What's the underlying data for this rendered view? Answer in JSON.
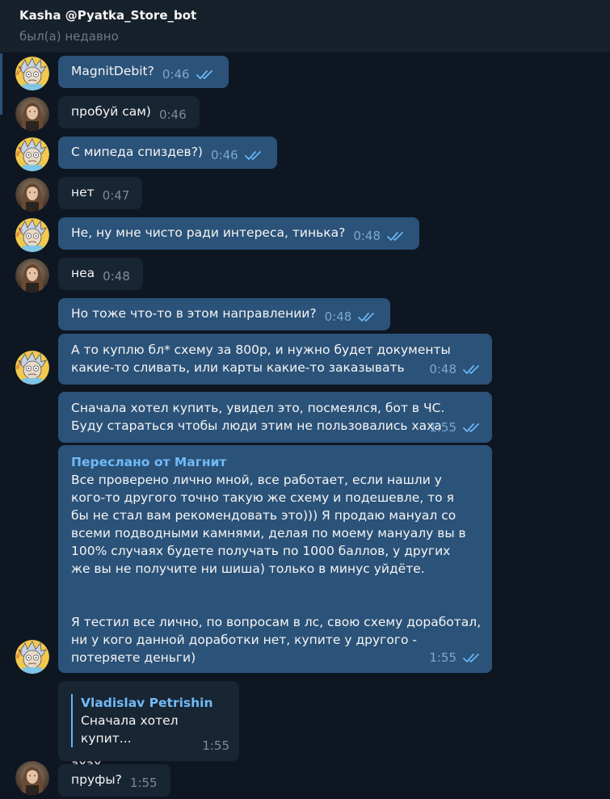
{
  "chat": {
    "title": "Kasha @Pyatka_Store_bot",
    "status": "был(а) недавно"
  },
  "messages": [
    {
      "text": "MagnitDebit?",
      "time": "0:46",
      "read": true
    },
    {
      "text": "пробуй сам)",
      "time": "0:46"
    },
    {
      "text": "С мипеда спиздев?)",
      "time": "0:46",
      "read": true
    },
    {
      "text": "нет",
      "time": "0:47"
    },
    {
      "text": "Не, ну мне чисто ради интереса, тинька?",
      "time": "0:48",
      "read": true
    },
    {
      "text": "неа",
      "time": "0:48"
    },
    {
      "text": "Но тоже что-то в этом направлении?",
      "time": "0:48",
      "read": true
    },
    {
      "text": "А то куплю бл* схему за 800р, и нужно будет документы какие-то сливать, или карты какие-то заказывать",
      "time": "0:48",
      "read": true
    },
    {
      "text": "Сначала хотел купить, увидел это, посмеялся, бот в ЧС. Буду стараться чтобы люди этим не пользовались хаха",
      "time": "1:55",
      "read": true
    },
    {
      "forwarded_from": "Переслано от Магнит",
      "text": "Все проверено лично мной, все работает, если нашли у кого-то другого точно такую же схему и подешевле, то я бы не стал вам рекомендовать это))) Я продаю мануал со всеми подводными камнями, делая по моему мануалу вы в 100% случаях будете получать по 1000 баллов, у других же вы не получите ни шиша) только в минус уйдёте.",
      "text2": "Я тестил все лично, по вопросам в лс, свою схему доработал, ни у кого данной доработки нет, купите у другого - потеряете деньги)",
      "time": "1:55",
      "read": true
    },
    {
      "reply_name": "Vladislav Petrishin",
      "reply_text": "Сначала хотел купит...",
      "text": "ахах",
      "time": "1:55"
    },
    {
      "text": "пруфы?",
      "time": "1:55"
    }
  ],
  "colors": {
    "background": "#0e1621",
    "header": "#17212b",
    "outgoing_bubble": "#2b5278",
    "incoming_bubble": "#182533",
    "accent": "#71baf6"
  },
  "icons": {
    "read_receipt": "double-check-icon",
    "avatar_self": "rick-avatar",
    "avatar_peer": "girl-avatar"
  }
}
